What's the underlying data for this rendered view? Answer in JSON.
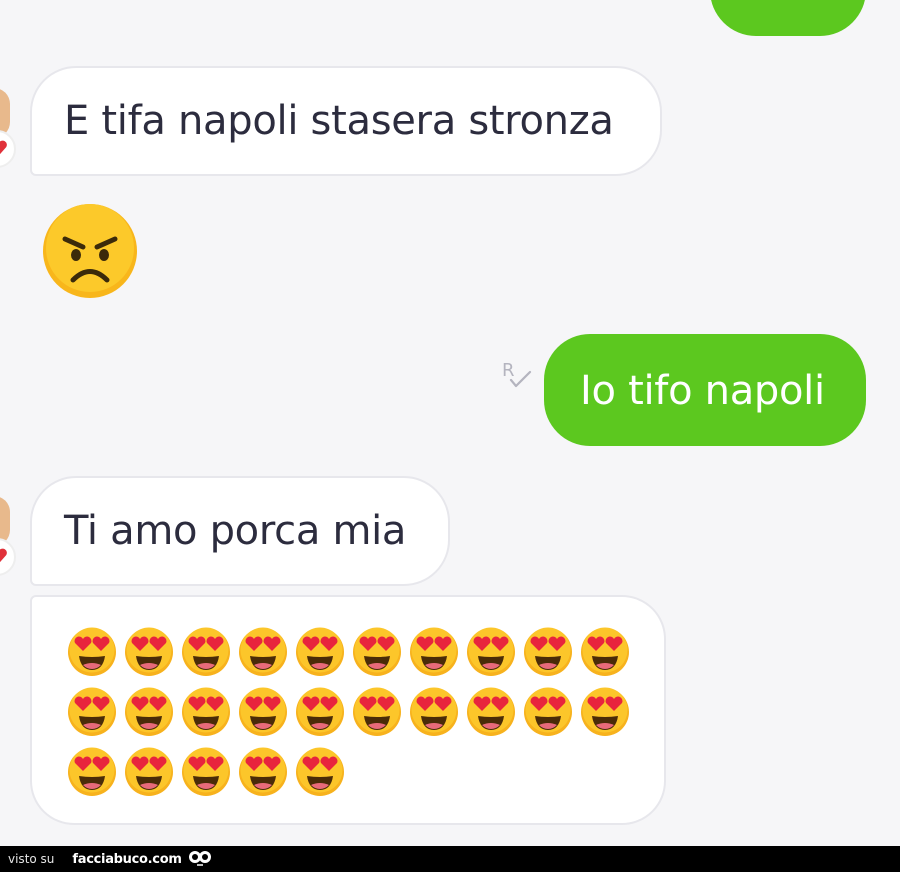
{
  "messages": {
    "m1": "E tifa napoli stasera stronza",
    "m2": "Io tifo napoli",
    "m3": "Ti amo porca mia"
  },
  "emoji_bubble": {
    "emoji": "smiling-face-with-heart-eyes",
    "count": 25
  },
  "reactions": {
    "angry_emoji": "angry-face"
  },
  "receipt": {
    "label": "R"
  },
  "footer": {
    "seen_on": "visto su",
    "site": "facciabuco.com"
  },
  "colors": {
    "outgoing_bubble": "#5cc81f",
    "incoming_bubble": "#ffffff",
    "background": "#f6f6f8",
    "text_incoming": "#2c2c3e"
  }
}
